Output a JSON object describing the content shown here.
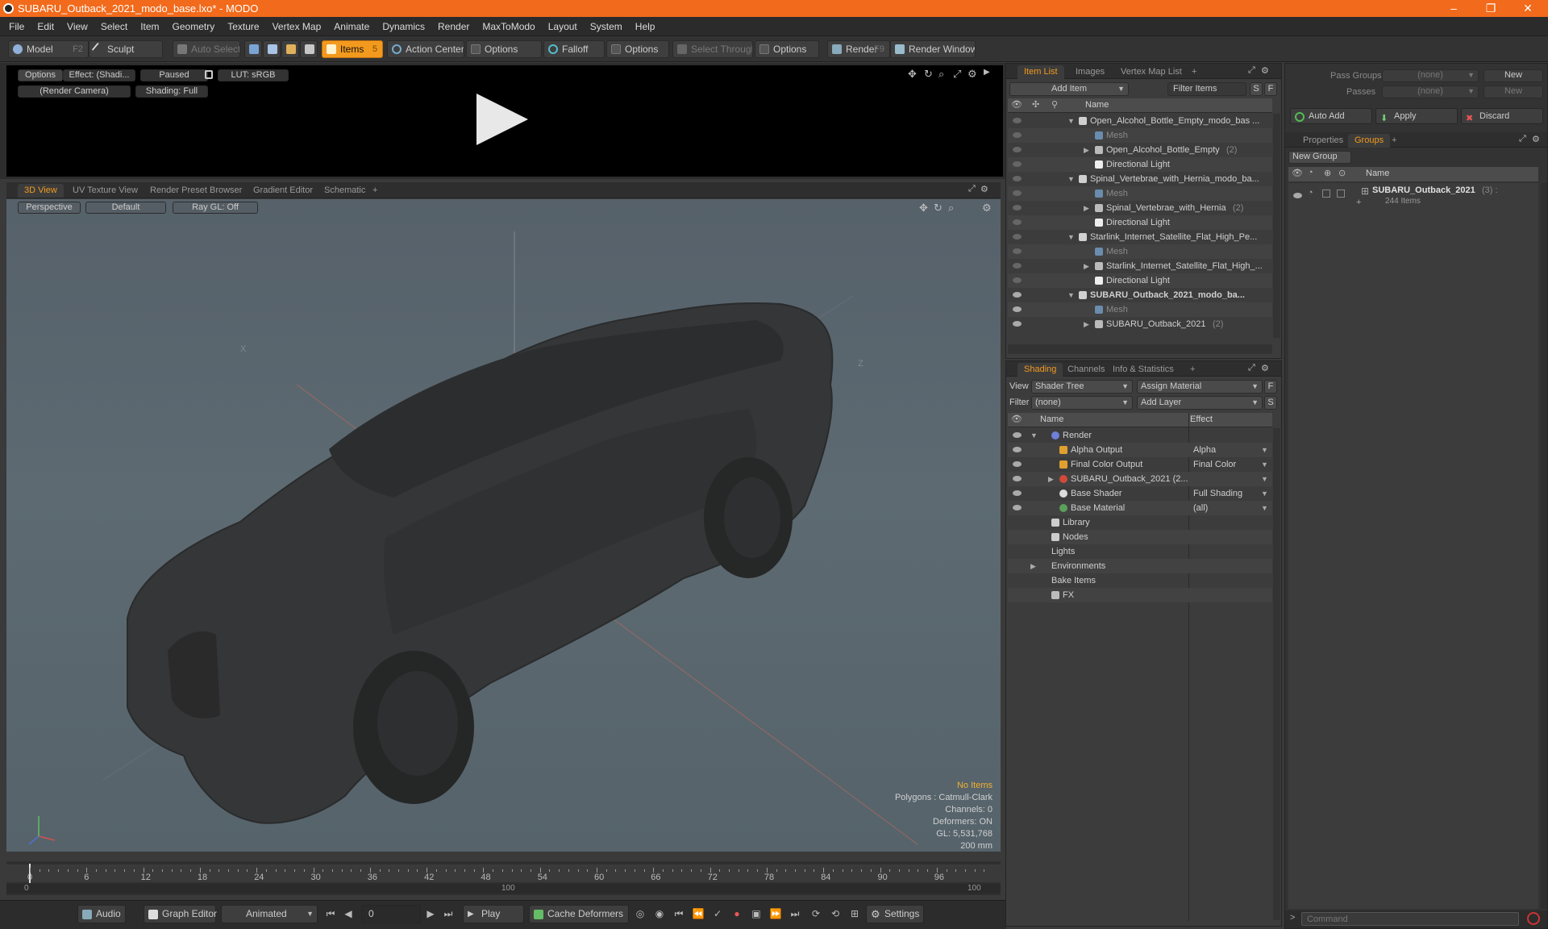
{
  "window": {
    "title": "SUBARU_Outback_2021_modo_base.lxo* - MODO",
    "minimize": "–",
    "maximize": "❐",
    "close": "✕"
  },
  "menu": [
    "File",
    "Edit",
    "View",
    "Select",
    "Item",
    "Geometry",
    "Texture",
    "Vertex Map",
    "Animate",
    "Dynamics",
    "Render",
    "MaxToModo",
    "Layout",
    "System",
    "Help"
  ],
  "toolbar": {
    "model": "Model",
    "model_key": "F2",
    "sculpt": "Sculpt",
    "auto_select": "Auto Select",
    "items": "Items",
    "items_key": "5",
    "action_center": "Action Center",
    "options1": "Options",
    "falloff": "Falloff",
    "options2": "Options",
    "select_through": "Select Through",
    "options3": "Options",
    "render": "Render",
    "render_key": "F9",
    "render_window": "Render Window"
  },
  "preview": {
    "options": "Options",
    "effect": "Effect: (Shadi...",
    "paused": "Paused",
    "lut": "LUT: sRGB",
    "camera": "(Render Camera)",
    "shading": "Shading: Full"
  },
  "viewport_tabs": [
    "3D View",
    "UV Texture View",
    "Render Preset Browser",
    "Gradient Editor",
    "Schematic",
    "+"
  ],
  "viewport": {
    "perspective": "Perspective",
    "default": "Default",
    "raygl": "Ray GL: Off",
    "axis_x": "X",
    "axis_z": "Z",
    "info": [
      "No Items",
      "Polygons : Catmull-Clark",
      "Channels: 0",
      "Deformers: ON",
      "GL: 5,531,768",
      "200 mm"
    ]
  },
  "timeline": {
    "ticks": [
      "0",
      "6",
      "12",
      "18",
      "24",
      "30",
      "36",
      "42",
      "48",
      "54",
      "60",
      "66",
      "72",
      "78",
      "84",
      "90",
      "96"
    ],
    "sub_start": "0",
    "sub_mid": "100",
    "sub_end": "100"
  },
  "bottombar": {
    "audio": "Audio",
    "graph_editor": "Graph Editor",
    "animated": "Animated",
    "frame": "0",
    "play": "Play",
    "cache_deformers": "Cache Deformers",
    "settings": "Settings"
  },
  "item_list": {
    "tabs": [
      "Item List",
      "Images",
      "Vertex Map List",
      "+"
    ],
    "add_item": "Add Item",
    "filter_items": "Filter Items",
    "s": "S",
    "f": "F",
    "col_name": "Name",
    "rows": [
      {
        "label": "Open_Alcohol_Bottle_Empty_modo_bas ...",
        "count": "",
        "level": 0,
        "kind": "scene",
        "bold": false
      },
      {
        "label": "Mesh",
        "count": "",
        "level": 1,
        "kind": "mesh",
        "bold": false
      },
      {
        "label": "Open_Alcohol_Bottle_Empty",
        "count": "(2)",
        "level": 1,
        "kind": "group",
        "bold": false
      },
      {
        "label": "Directional Light",
        "count": "",
        "level": 1,
        "kind": "light",
        "bold": false
      },
      {
        "label": "Spinal_Vertebrae_with_Hernia_modo_ba...",
        "count": "",
        "level": 0,
        "kind": "scene",
        "bold": false
      },
      {
        "label": "Mesh",
        "count": "",
        "level": 1,
        "kind": "mesh",
        "bold": false
      },
      {
        "label": "Spinal_Vertebrae_with_Hernia",
        "count": "(2)",
        "level": 1,
        "kind": "group",
        "bold": false
      },
      {
        "label": "Directional Light",
        "count": "",
        "level": 1,
        "kind": "light",
        "bold": false
      },
      {
        "label": "Starlink_Internet_Satellite_Flat_High_Pe...",
        "count": "",
        "level": 0,
        "kind": "scene",
        "bold": false
      },
      {
        "label": "Mesh",
        "count": "",
        "level": 1,
        "kind": "mesh",
        "bold": false
      },
      {
        "label": "Starlink_Internet_Satellite_Flat_High_...",
        "count": "",
        "level": 1,
        "kind": "group",
        "bold": false
      },
      {
        "label": "Directional Light",
        "count": "",
        "level": 1,
        "kind": "light",
        "bold": false
      },
      {
        "label": "SUBARU_Outback_2021_modo_ba...",
        "count": "",
        "level": 0,
        "kind": "scene",
        "bold": true
      },
      {
        "label": "Mesh",
        "count": "",
        "level": 1,
        "kind": "mesh",
        "bold": false
      },
      {
        "label": "SUBARU_Outback_2021",
        "count": "(2)",
        "level": 1,
        "kind": "group",
        "bold": false
      }
    ]
  },
  "shading": {
    "tabs": [
      "Shading",
      "Channels",
      "Info & Statistics",
      "+"
    ],
    "view_label": "View",
    "view_value": "Shader Tree",
    "assign_material": "Assign Material",
    "filter_label": "Filter",
    "filter_value": "(none)",
    "add_layer": "Add Layer",
    "f": "F",
    "s": "S",
    "col_name": "Name",
    "col_effect": "Effect",
    "rows": [
      {
        "label": "Render",
        "effect": "",
        "level": 0,
        "kind": "render"
      },
      {
        "label": "Alpha Output",
        "effect": "Alpha",
        "level": 1,
        "kind": "output"
      },
      {
        "label": "Final Color Output",
        "effect": "Final Color",
        "level": 1,
        "kind": "output"
      },
      {
        "label": "SUBARU_Outback_2021 (2...",
        "effect": "",
        "level": 1,
        "kind": "mat"
      },
      {
        "label": "Base Shader",
        "effect": "Full Shading",
        "level": 1,
        "kind": "shader"
      },
      {
        "label": "Base Material",
        "effect": "(all)",
        "level": 1,
        "kind": "material"
      },
      {
        "label": "Library",
        "effect": "",
        "level": 0,
        "kind": "folder"
      },
      {
        "label": "Nodes",
        "effect": "",
        "level": 0,
        "kind": "folder"
      },
      {
        "label": "Lights",
        "effect": "",
        "level": 0,
        "kind": "none"
      },
      {
        "label": "Environments",
        "effect": "",
        "level": 0,
        "kind": "none"
      },
      {
        "label": "Bake Items",
        "effect": "",
        "level": 0,
        "kind": "none"
      },
      {
        "label": "FX",
        "effect": "",
        "level": 0,
        "kind": "fx"
      }
    ]
  },
  "groups_panel": {
    "pass_groups_label": "Pass Groups",
    "pass_groups_value": "(none)",
    "new1": "New",
    "passes_label": "Passes",
    "passes_value": "(none)",
    "new2": "New",
    "auto_add": "Auto Add",
    "apply": "Apply",
    "discard": "Discard",
    "tabs": [
      "Properties",
      "Groups",
      "+"
    ],
    "new_group": "New Group",
    "col_name": "Name",
    "group_name": "SUBARU_Outback_2021",
    "group_count": "(3) :",
    "group_items": "244 Items",
    "command_placeholder": "Command"
  }
}
